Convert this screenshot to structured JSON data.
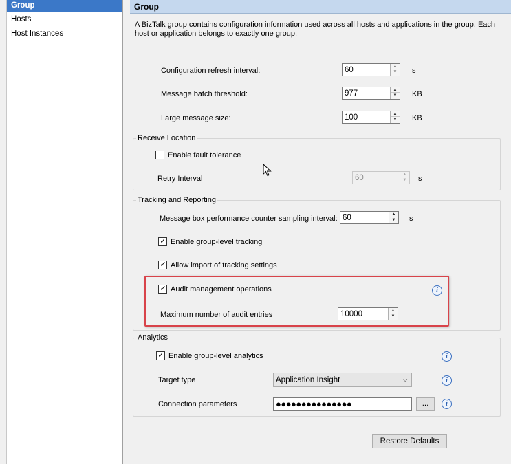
{
  "nav": {
    "items": [
      {
        "label": "Group",
        "selected": true
      },
      {
        "label": "Hosts",
        "selected": false
      },
      {
        "label": "Host Instances",
        "selected": false
      }
    ]
  },
  "header": {
    "title": "Group"
  },
  "description": "A BizTalk group contains configuration information used across all hosts and applications in the group. Each host or application belongs to exactly one group.",
  "general": {
    "config_refresh": {
      "label": "Configuration refresh interval:",
      "value": "60",
      "unit": "s"
    },
    "batch_threshold": {
      "label": "Message batch threshold:",
      "value": "977",
      "unit": "KB"
    },
    "large_message": {
      "label": "Large message size:",
      "value": "100",
      "unit": "KB"
    }
  },
  "receive_location": {
    "title": "Receive Location",
    "fault_tolerance": {
      "label": "Enable fault tolerance",
      "checked": false
    },
    "retry_interval": {
      "label": "Retry Interval",
      "value": "60",
      "unit": "s",
      "disabled": true
    }
  },
  "tracking": {
    "title": "Tracking and Reporting",
    "sampling": {
      "label": "Message box performance counter sampling interval:",
      "value": "60",
      "unit": "s"
    },
    "group_tracking": {
      "label": "Enable group-level tracking",
      "checked": true
    },
    "import_settings": {
      "label": "Allow import of tracking settings",
      "checked": true
    },
    "audit_ops": {
      "label": "Audit management operations",
      "checked": true
    },
    "max_audit": {
      "label": "Maximum number of audit entries",
      "value": "10000"
    }
  },
  "analytics": {
    "title": "Analytics",
    "group_analytics": {
      "label": "Enable group-level analytics",
      "checked": true
    },
    "target_type": {
      "label": "Target type",
      "value": "Application Insight"
    },
    "connection": {
      "label": "Connection parameters",
      "value": "●●●●●●●●●●●●●●●",
      "browse_label": "..."
    }
  },
  "footer": {
    "restore_label": "Restore Defaults"
  },
  "glyphs": {
    "check": "✓",
    "up": "▲",
    "down": "▼",
    "info": "i",
    "combo_arrow": "⌵"
  },
  "colors": {
    "selection": "#3b78c8",
    "header": "#c5d8ee",
    "highlight": "#d8434a",
    "info": "#3a6fc0"
  }
}
